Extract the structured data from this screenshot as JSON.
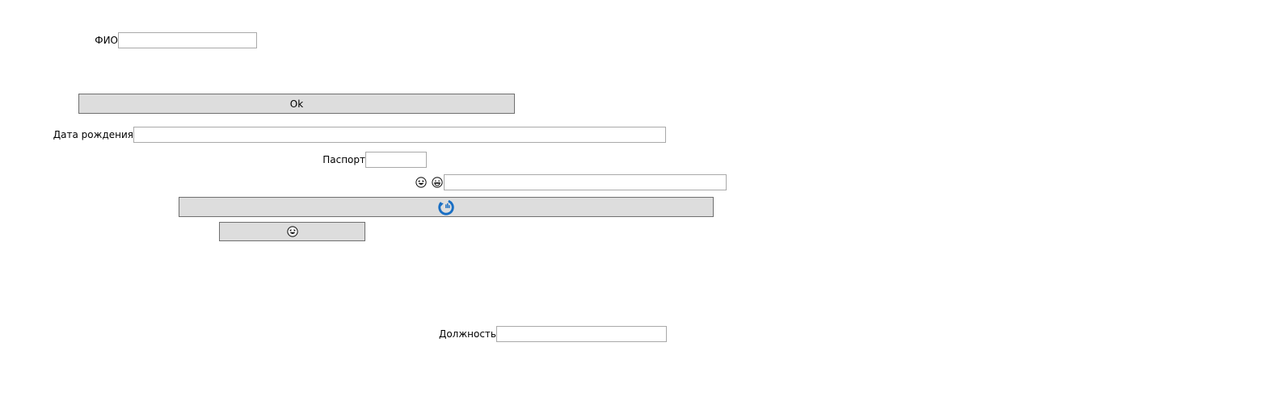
{
  "form": {
    "fio": {
      "label": "ФИО",
      "value": "",
      "placeholder": ""
    },
    "ok_button": {
      "label": "Ok"
    },
    "birthdate": {
      "label": "Дата рождения",
      "value": "",
      "placeholder": ""
    },
    "passport": {
      "label": "Паспорт",
      "value": "",
      "placeholder": ""
    },
    "emoji_field": {
      "icons": [
        "laughing-face-icon",
        "grinning-face-icon"
      ],
      "value": "",
      "placeholder": ""
    },
    "refresh_button": {
      "icon": "blue-refresh-icon",
      "icon_color": "#1a6fc4"
    },
    "emoji_button": {
      "icon": "laughing-face-icon"
    },
    "position": {
      "label": "Должность",
      "value": "",
      "placeholder": ""
    }
  },
  "colors": {
    "button_bg": "#dddddd",
    "button_border": "#707070",
    "field_border": "#a9a9a9",
    "accent_blue": "#1a6fc4"
  }
}
